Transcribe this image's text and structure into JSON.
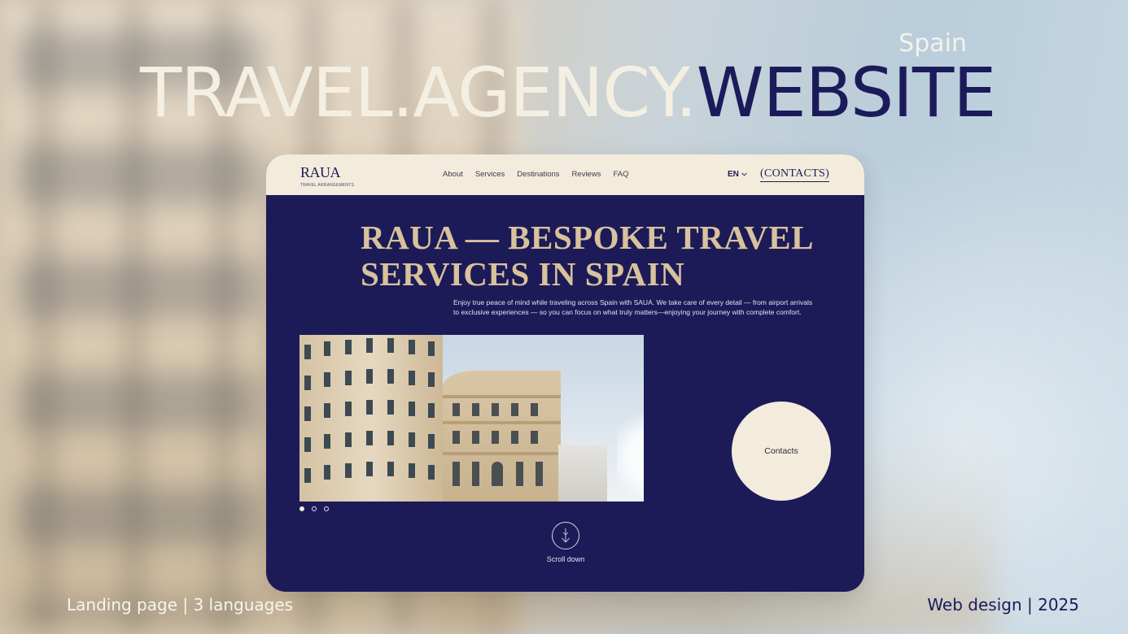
{
  "slide": {
    "region": "Spain",
    "title_part1": "TRAVEL.AGENCY.",
    "title_part2": "WEBSITE",
    "footer_left": "Landing page | 3 languages",
    "footer_right": "Web design | 2025"
  },
  "site": {
    "logo": "RAUA",
    "logo_subtitle": "TRAVEL ARRANGEMENTS",
    "nav": [
      "About",
      "Services",
      "Destinations",
      "Reviews",
      "FAQ"
    ],
    "language": "EN",
    "contacts_link": "(CONTACTS)",
    "hero_heading": "RAUA — BESPOKE TRAVEL SERVICES IN SPAIN",
    "hero_description": "Enjoy true peace of mind  while traveling across Spain with SAUA. We take care of every detail — from airport arrivals to exclusive experiences — so you can focus on what truly matters—enjoying your journey with complete comfort.",
    "contacts_button": "Contacts",
    "scroll_label": "Scroll down",
    "slider": {
      "total": 3,
      "active": 1
    }
  },
  "colors": {
    "navy": "#1c1b58",
    "cream": "#f3ecdd",
    "gold": "#d9c19c"
  },
  "icons": [
    "chevron-down-icon",
    "arrow-down-icon"
  ]
}
